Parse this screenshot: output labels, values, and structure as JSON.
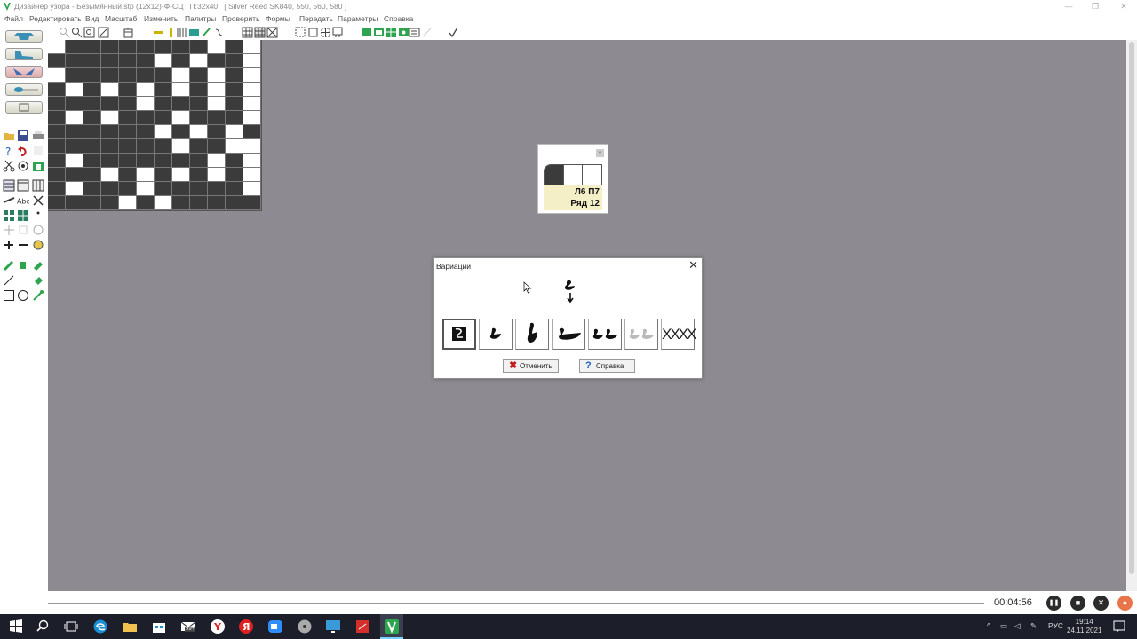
{
  "window": {
    "title": "Дизайнер узора - Безымянный.stp (12х12)-Ф-СЦ",
    "size_info": "П:32х40",
    "machine": "[ Silver Reed SK840, 550, 560, 580 ]",
    "minimize_glyph": "—",
    "maximize_glyph": "❐",
    "close_glyph": "✕"
  },
  "menu": [
    "Файл",
    "Редактировать",
    "Вид",
    "Масштаб",
    "Изменить",
    "Палитры",
    "Проверить",
    "Формы",
    "Передать",
    "Параметры",
    "Справка"
  ],
  "pattern": {
    "rows": [
      "011111111010",
      "111111010110",
      "011111101010",
      "101010101010",
      "111110111010",
      "101011101110",
      "111111010101",
      "111111101100",
      "101111111010",
      "111010101010",
      "101110111110",
      "111101011111"
    ]
  },
  "row_panel": {
    "close_glyph": "×",
    "stitch_label": "Л6 П7",
    "row_label": "Ряд 12"
  },
  "dialog": {
    "title": "Вариации",
    "close_glyph": "✕",
    "cancel_label": "Отменить",
    "cancel_glyph": "✖",
    "help_label": "Справка",
    "help_glyph": "?",
    "xxxx_label": "XXXX"
  },
  "recorder": {
    "elapsed": "00:04:56",
    "pause_glyph": "❚❚",
    "stop_glyph": "■",
    "close_glyph": "✕",
    "mic_glyph": "●"
  },
  "taskbar": {
    "language": "РУС",
    "time": "19:14",
    "date": "24.11.2021",
    "badge": "99+"
  },
  "colors": {
    "canvas": "#8d8a91",
    "stitch_dark": "#3b3b3b",
    "stitch_light": "#ffffff",
    "row_info_bg": "#f5efc8",
    "taskbar": "#1c1e2a",
    "accent_green": "#2da44e"
  }
}
